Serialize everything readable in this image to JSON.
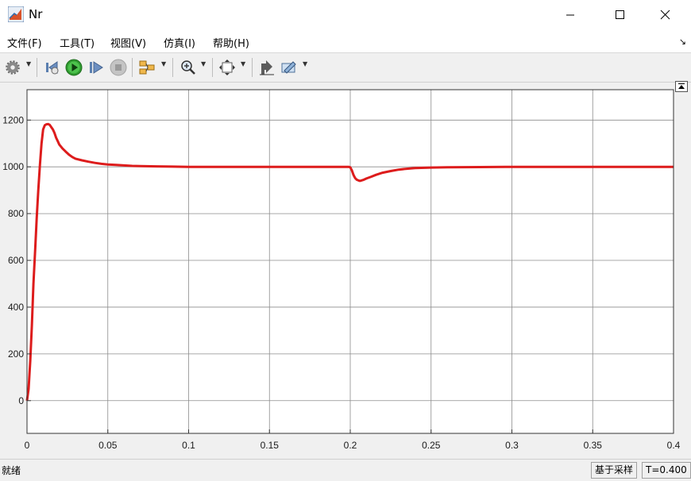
{
  "window": {
    "title": "Nr",
    "icon": "matlab-icon",
    "controls": [
      "minimize-icon",
      "maximize-icon",
      "close-icon"
    ]
  },
  "menu": {
    "items": [
      "文件(F)",
      "工具(T)",
      "视图(V)",
      "仿真(I)",
      "帮助(H)"
    ],
    "expand_glyph": "↘"
  },
  "toolbar": {
    "icons": [
      "settings-icon",
      "step-back-icon",
      "run-icon",
      "step-forward-icon",
      "stop-icon",
      "signal-select-icon",
      "zoom-in-icon",
      "autoscale-icon",
      "cursor-measure-icon",
      "triggers-icon"
    ]
  },
  "chart_data": {
    "type": "line",
    "title": "",
    "xlabel": "",
    "ylabel": "",
    "xlim": [
      0,
      0.4
    ],
    "ylim": [
      -140,
      1330
    ],
    "xticks": [
      "0",
      "0.05",
      "0.1",
      "0.15",
      "0.2",
      "0.25",
      "0.3",
      "0.35",
      "0.4"
    ],
    "yticks": [
      "0",
      "200",
      "400",
      "600",
      "800",
      "1000",
      "1200"
    ],
    "grid": true,
    "line_color": "#dd1c1c",
    "series": [
      {
        "x": [
          0,
          0.001,
          0.002,
          0.003,
          0.004,
          0.005,
          0.006,
          0.007,
          0.008,
          0.009,
          0.01,
          0.011,
          0.012,
          0.013,
          0.014,
          0.015,
          0.016,
          0.017,
          0.018,
          0.019,
          0.02,
          0.022,
          0.024,
          0.026,
          0.028,
          0.03,
          0.034,
          0.038,
          0.042,
          0.046,
          0.05,
          0.055,
          0.06,
          0.065,
          0.07,
          0.08,
          0.09,
          0.1,
          0.12,
          0.14,
          0.16,
          0.18,
          0.19,
          0.199,
          0.2,
          0.201,
          0.202,
          0.203,
          0.204,
          0.205,
          0.206,
          0.208,
          0.21,
          0.213,
          0.216,
          0.22,
          0.225,
          0.23,
          0.235,
          0.24,
          0.25,
          0.26,
          0.28,
          0.3,
          0.32,
          0.35,
          0.38,
          0.4
        ],
        "y": [
          0,
          50,
          170,
          320,
          500,
          640,
          780,
          900,
          1010,
          1100,
          1160,
          1178,
          1182,
          1183,
          1180,
          1170,
          1160,
          1145,
          1125,
          1110,
          1095,
          1078,
          1065,
          1052,
          1042,
          1035,
          1028,
          1022,
          1017,
          1013,
          1010,
          1008,
          1006,
          1004,
          1003,
          1002,
          1001,
          1000,
          1000,
          1000,
          1000,
          1000,
          1000,
          1000,
          998,
          985,
          965,
          952,
          945,
          942,
          940,
          944,
          950,
          958,
          966,
          975,
          982,
          988,
          992,
          995,
          997,
          998,
          999,
          1000,
          1000,
          1000,
          1000,
          1000
        ]
      }
    ]
  },
  "status": {
    "text": "就绪",
    "sampling": "基于采样",
    "time": "T=0.400"
  }
}
